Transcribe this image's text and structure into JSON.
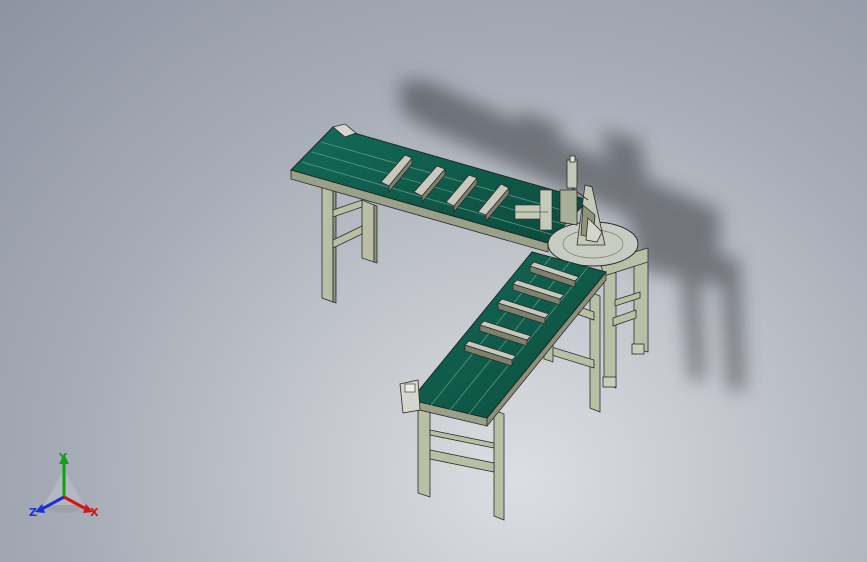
{
  "view": {
    "background_top": "#8c94a2",
    "background_bottom": "#d9dbe0",
    "belt_color": "#0f5a4a",
    "frame_color": "#b9bfa5",
    "frame_edge": "#2b2b2b",
    "shadow_color": "#3a3d42"
  },
  "triad": {
    "x_label": "X",
    "y_label": "Y",
    "z_label": "Z",
    "x_color": "#d51515",
    "y_color": "#12a017",
    "z_color": "#1a32d4"
  }
}
